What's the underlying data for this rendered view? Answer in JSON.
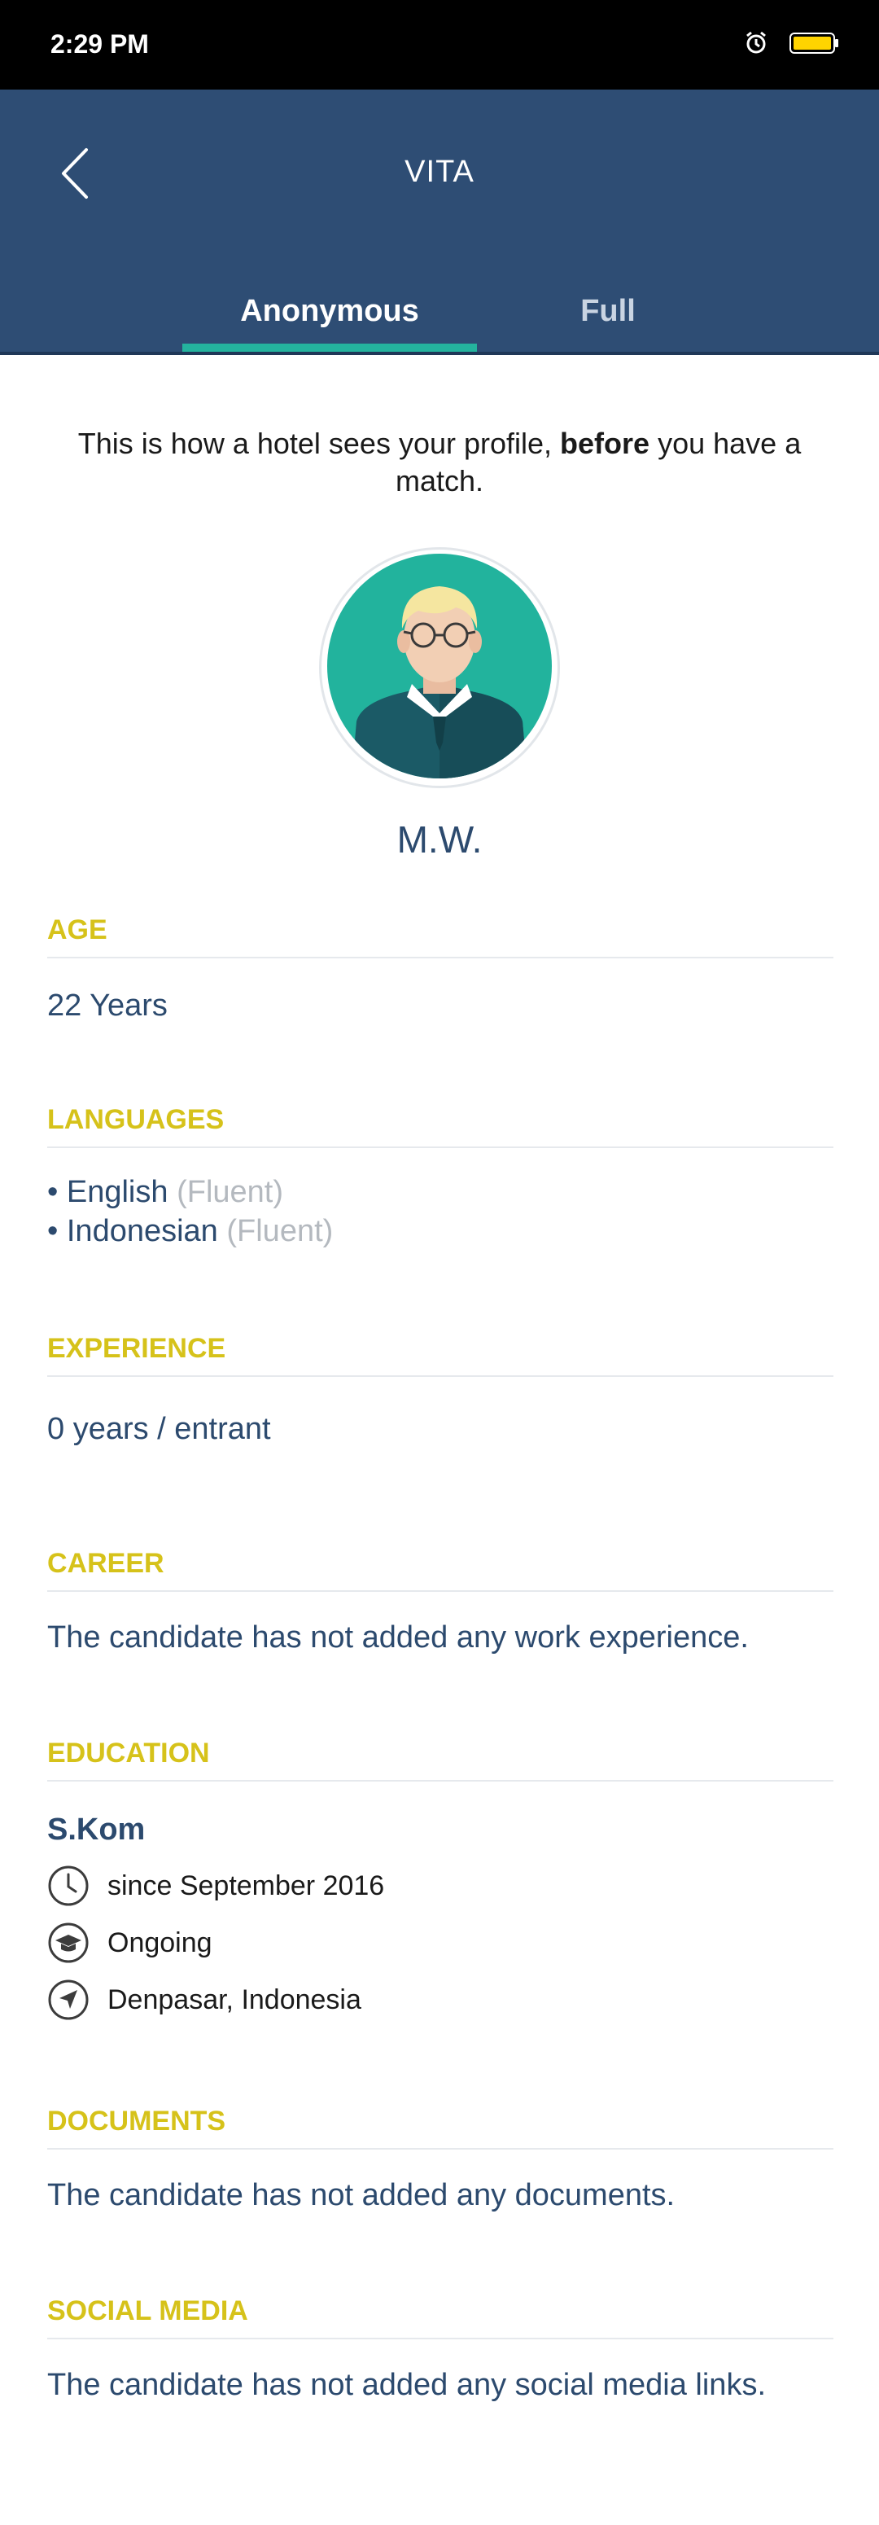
{
  "status_bar": {
    "time": "2:29 PM",
    "icons": [
      "alarm-icon",
      "battery-icon"
    ],
    "battery_color": "#ffd400"
  },
  "header": {
    "title": "VITA",
    "back_icon": "chevron-left-icon",
    "tabs": [
      {
        "label": "Anonymous",
        "active": true
      },
      {
        "label": "Full",
        "active": false
      }
    ],
    "background": "#2e4d74",
    "accent": "#24b39e"
  },
  "profile": {
    "intro_before": "This is how a hotel sees your profile, ",
    "intro_bold": "before",
    "intro_after": " you have a match.",
    "avatar_icon": "user-avatar-icon",
    "name": "M.W."
  },
  "sections": {
    "age": {
      "title": "AGE",
      "value": "22 Years"
    },
    "languages": {
      "title": "LANGUAGES",
      "items": [
        {
          "bullet": "• ",
          "name": "English",
          "level": "(Fluent)"
        },
        {
          "bullet": "• ",
          "name": "Indonesian",
          "level": "(Fluent)"
        }
      ]
    },
    "experience": {
      "title": "EXPERIENCE",
      "value": "0 years / entrant"
    },
    "career": {
      "title": "CAREER",
      "value": "The candidate has not added any work experience."
    },
    "education": {
      "title": "EDUCATION",
      "degree": "S.Kom",
      "since": "since September 2016",
      "status": "Ongoing",
      "location": "Denpasar, Indonesia",
      "icons": [
        "clock-icon",
        "graduation-cap-icon",
        "location-arrow-icon"
      ]
    },
    "documents": {
      "title": "DOCUMENTS",
      "value": "The candidate has not added any documents."
    },
    "social_media": {
      "title": "SOCIAL MEDIA",
      "value": "The candidate has not added any social media links."
    }
  },
  "colors": {
    "section_title": "#d6c21a",
    "text_primary": "#2c4a6e",
    "text_muted": "#b4b9bf"
  }
}
